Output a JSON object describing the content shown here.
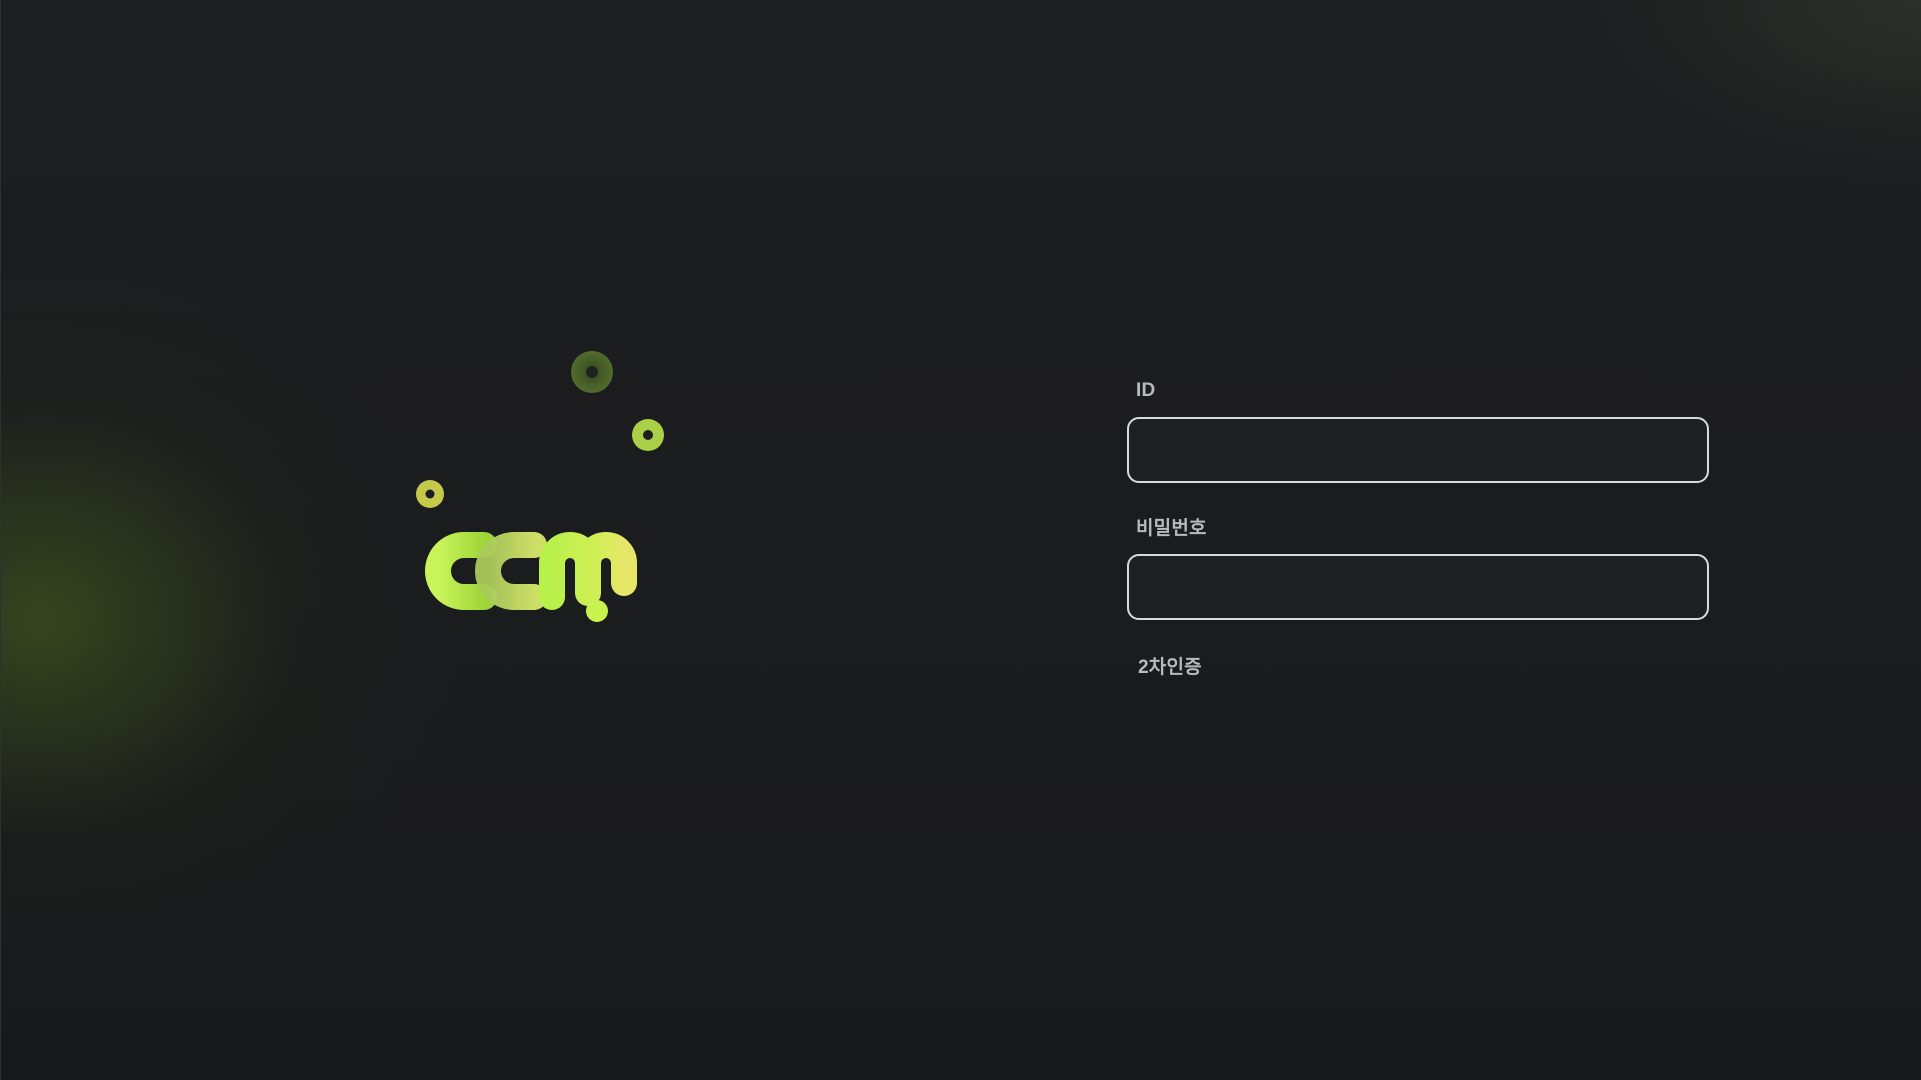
{
  "logo": {
    "text": "ccm",
    "icon": "ccm-logo-icon",
    "colors": {
      "lime": "#c6f34e",
      "yellow_green": "#dfe85a",
      "dark_green": "#5c7a2c"
    }
  },
  "login": {
    "id_label": "ID",
    "id_value": "",
    "password_label": "비밀번호",
    "password_value": "",
    "otp_label": "2차인증"
  },
  "theme": {
    "background": "#1c1d1f",
    "input_border": "#d9dadd",
    "label_color": "#b9babd"
  }
}
